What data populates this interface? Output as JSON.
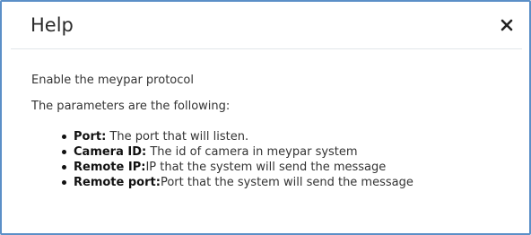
{
  "dialog": {
    "title": "Help",
    "close_icon": "close-icon",
    "intro": "Enable the meypar protocol",
    "params_heading": "The parameters are the following:",
    "params": [
      {
        "name": "Port:",
        "desc": " The port that will listen."
      },
      {
        "name": "Camera ID:",
        "desc": " The id of camera in meypar system"
      },
      {
        "name": "Remote IP:",
        "desc": "IP that the system will send the message"
      },
      {
        "name": "Remote port:",
        "desc": "Port that the system will send the message"
      }
    ]
  },
  "colors": {
    "frame_border": "#5b8fc7",
    "title_text": "#2b2b2b",
    "body_text": "#333333"
  }
}
